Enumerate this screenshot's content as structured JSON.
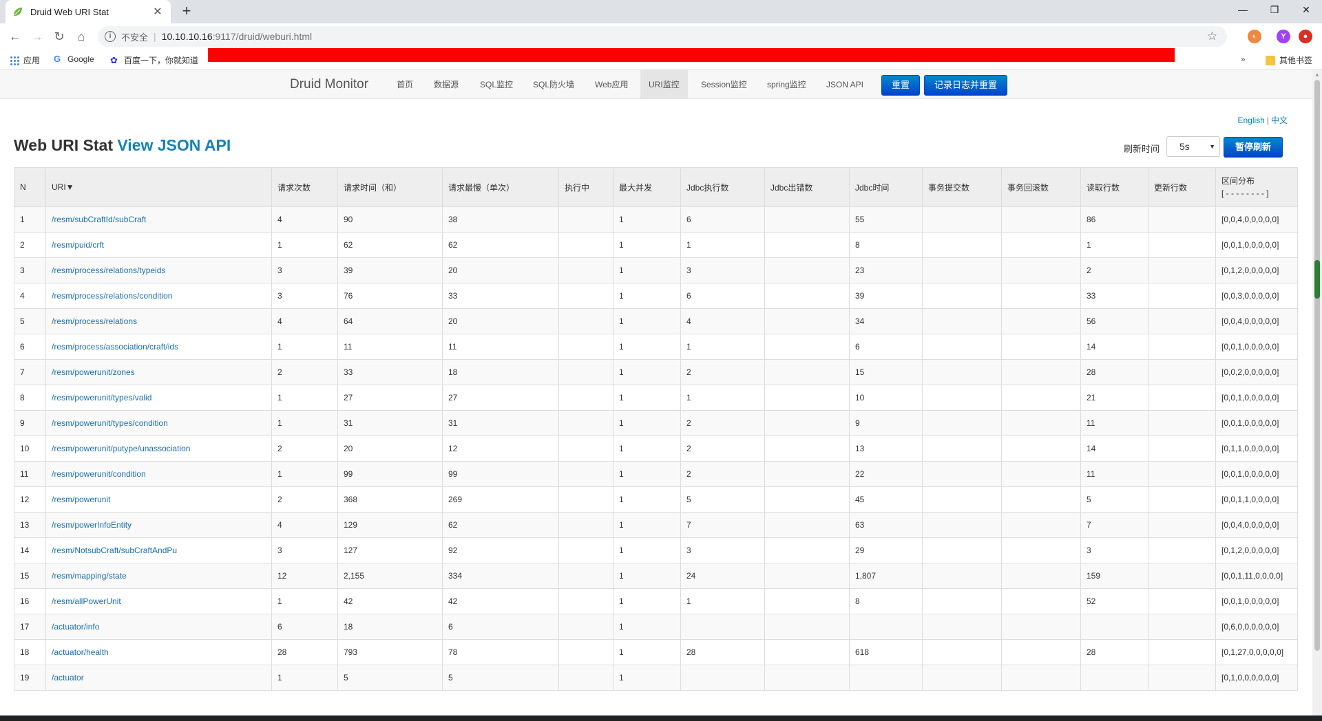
{
  "browser": {
    "tab_title": "Druid Web URI Stat",
    "new_tab": "+",
    "insecure_label": "不安全",
    "url_host": "10.10.10.16",
    "url_path": ":9117/druid/weburi.html",
    "bookmarks": {
      "apps": "应用",
      "google": "Google",
      "baidu": "百度一下，你就知道",
      "other": "其他书签"
    },
    "profile_letter": "Y"
  },
  "nav": {
    "brand": "Druid Monitor",
    "links": [
      "首页",
      "数据源",
      "SQL监控",
      "SQL防火墙",
      "Web应用",
      "URI监控",
      "Session监控",
      "spring监控",
      "JSON API"
    ],
    "active": "URI监控",
    "reset": "重置",
    "log_reset": "记录日志并重置"
  },
  "lang": {
    "en": "English",
    "sep": "|",
    "zh": "中文"
  },
  "heading": {
    "title": "Web URI Stat",
    "link": "View JSON API"
  },
  "refresh": {
    "label": "刷新时间",
    "value": "5s",
    "pause": "暂停刷新"
  },
  "table": {
    "headers": [
      "N",
      "URI▼",
      "请求次数",
      "请求时间（和）",
      "请求最慢（单次）",
      "执行中",
      "最大并发",
      "Jdbc执行数",
      "Jdbc出错数",
      "Jdbc时间",
      "事务提交数",
      "事务回滚数",
      "读取行数",
      "更新行数",
      "区间分布",
      "[ - - - - - - - - ]"
    ],
    "rows": [
      [
        "1",
        "/resm/subCraftId/subCraft",
        "4",
        "90",
        "38",
        "",
        "1",
        "6",
        "",
        "55",
        "",
        "",
        "86",
        "",
        "[0,0,4,0,0,0,0,0]"
      ],
      [
        "2",
        "/resm/puid/crft",
        "1",
        "62",
        "62",
        "",
        "1",
        "1",
        "",
        "8",
        "",
        "",
        "1",
        "",
        "[0,0,1,0,0,0,0,0]"
      ],
      [
        "3",
        "/resm/process/relations/typeids",
        "3",
        "39",
        "20",
        "",
        "1",
        "3",
        "",
        "23",
        "",
        "",
        "2",
        "",
        "[0,1,2,0,0,0,0,0]"
      ],
      [
        "4",
        "/resm/process/relations/condition",
        "3",
        "76",
        "33",
        "",
        "1",
        "6",
        "",
        "39",
        "",
        "",
        "33",
        "",
        "[0,0,3,0,0,0,0,0]"
      ],
      [
        "5",
        "/resm/process/relations",
        "4",
        "64",
        "20",
        "",
        "1",
        "4",
        "",
        "34",
        "",
        "",
        "56",
        "",
        "[0,0,4,0,0,0,0,0]"
      ],
      [
        "6",
        "/resm/process/association/craft/ids",
        "1",
        "11",
        "11",
        "",
        "1",
        "1",
        "",
        "6",
        "",
        "",
        "14",
        "",
        "[0,0,1,0,0,0,0,0]"
      ],
      [
        "7",
        "/resm/powerunit/zones",
        "2",
        "33",
        "18",
        "",
        "1",
        "2",
        "",
        "15",
        "",
        "",
        "28",
        "",
        "[0,0,2,0,0,0,0,0]"
      ],
      [
        "8",
        "/resm/powerunit/types/valid",
        "1",
        "27",
        "27",
        "",
        "1",
        "1",
        "",
        "10",
        "",
        "",
        "21",
        "",
        "[0,0,1,0,0,0,0,0]"
      ],
      [
        "9",
        "/resm/powerunit/types/condition",
        "1",
        "31",
        "31",
        "",
        "1",
        "2",
        "",
        "9",
        "",
        "",
        "11",
        "",
        "[0,0,1,0,0,0,0,0]"
      ],
      [
        "10",
        "/resm/powerunit/putype/unassociation",
        "2",
        "20",
        "12",
        "",
        "1",
        "2",
        "",
        "13",
        "",
        "",
        "14",
        "",
        "[0,1,1,0,0,0,0,0]"
      ],
      [
        "11",
        "/resm/powerunit/condition",
        "1",
        "99",
        "99",
        "",
        "1",
        "2",
        "",
        "22",
        "",
        "",
        "11",
        "",
        "[0,0,1,0,0,0,0,0]"
      ],
      [
        "12",
        "/resm/powerunit",
        "2",
        "368",
        "269",
        "",
        "1",
        "5",
        "",
        "45",
        "",
        "",
        "5",
        "",
        "[0,0,1,1,0,0,0,0]"
      ],
      [
        "13",
        "/resm/powerInfoEntity",
        "4",
        "129",
        "62",
        "",
        "1",
        "7",
        "",
        "63",
        "",
        "",
        "7",
        "",
        "[0,0,4,0,0,0,0,0]"
      ],
      [
        "14",
        "/resm/NotsubCraft/subCraftAndPu",
        "3",
        "127",
        "92",
        "",
        "1",
        "3",
        "",
        "29",
        "",
        "",
        "3",
        "",
        "[0,1,2,0,0,0,0,0]"
      ],
      [
        "15",
        "/resm/mapping/state",
        "12",
        "2,155",
        "334",
        "",
        "1",
        "24",
        "",
        "1,807",
        "",
        "",
        "159",
        "",
        "[0,0,1,11,0,0,0,0]"
      ],
      [
        "16",
        "/resm/allPowerUnit",
        "1",
        "42",
        "42",
        "",
        "1",
        "1",
        "",
        "8",
        "",
        "",
        "52",
        "",
        "[0,0,1,0,0,0,0,0]"
      ],
      [
        "17",
        "/actuator/info",
        "6",
        "18",
        "6",
        "",
        "1",
        "",
        "",
        "",
        "",
        "",
        "",
        "",
        "[0,6,0,0,0,0,0,0]"
      ],
      [
        "18",
        "/actuator/health",
        "28",
        "793",
        "78",
        "",
        "1",
        "28",
        "",
        "618",
        "",
        "",
        "28",
        "",
        "[0,1,27,0,0,0,0,0]"
      ],
      [
        "19",
        "/actuator",
        "1",
        "5",
        "5",
        "",
        "1",
        "",
        "",
        "",
        "",
        "",
        "",
        "",
        "[0,1,0,0,0,0,0,0]"
      ]
    ]
  },
  "colors": {
    "link": "#1a6fae",
    "primary": "#0055cc",
    "header_bg": "#eeeeee",
    "redaction": "#fe0000"
  }
}
